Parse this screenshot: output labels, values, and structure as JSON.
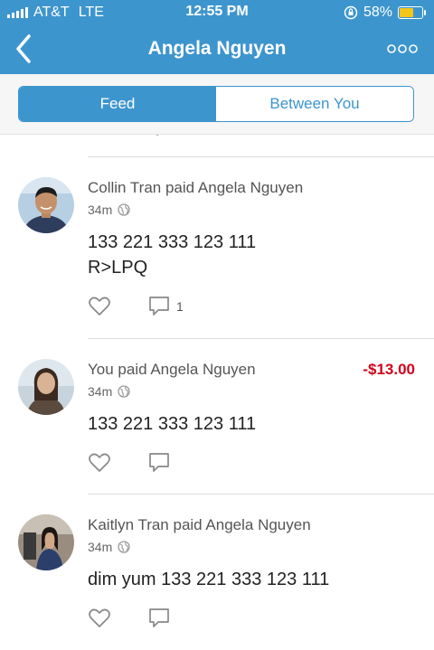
{
  "status_bar": {
    "carrier": "AT&T",
    "network": "LTE",
    "time": "12:55 PM",
    "battery_pct": "58%",
    "battery_level": 0.58,
    "icons": [
      "signal-bars-icon",
      "rotation-lock-icon",
      "battery-icon"
    ]
  },
  "nav": {
    "title": "Angela Nguyen",
    "back_icon": "chevron-left-icon",
    "more_icon": "more-dots-icon"
  },
  "tabs": [
    {
      "label": "Feed",
      "active": true
    },
    {
      "label": "Between You",
      "active": false
    }
  ],
  "feed": [
    {
      "line": "Collin Tran paid Angela Nguyen",
      "time": "34m",
      "message_lines": [
        "133 221 333 123 111",
        "R>LPQ"
      ],
      "amount": "",
      "comment_count": "1"
    },
    {
      "line": "You paid Angela Nguyen",
      "time": "34m",
      "message_lines": [
        "133 221 333 123 111"
      ],
      "amount": "-$13.00",
      "comment_count": ""
    },
    {
      "line": "Kaitlyn Tran paid Angela Nguyen",
      "time": "34m",
      "message_lines": [
        "dim yum 133 221 333 123 111"
      ],
      "amount": "",
      "comment_count": ""
    }
  ],
  "colors": {
    "brand": "#3d95ce",
    "negative_amount": "#d0021b",
    "battery": "#f5c518"
  }
}
